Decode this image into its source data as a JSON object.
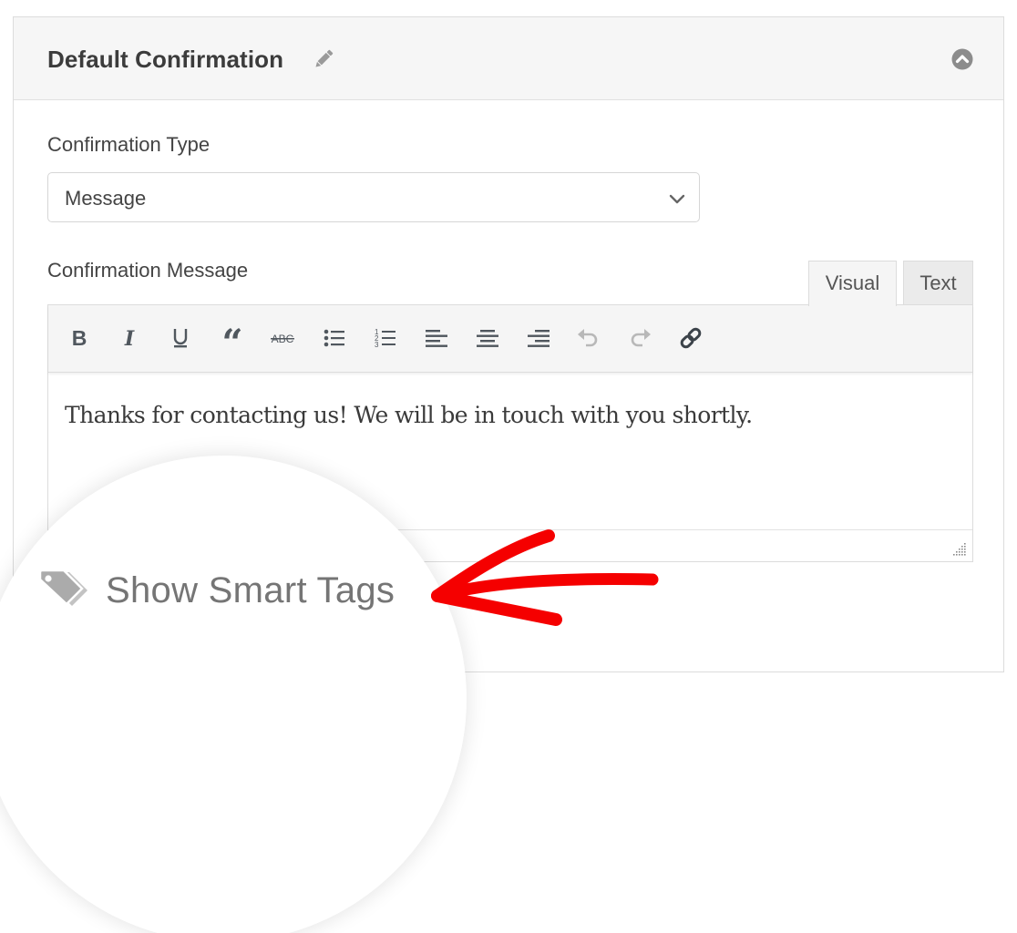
{
  "panel": {
    "title": "Default Confirmation",
    "edit_icon": "pencil-icon",
    "collapse_icon": "chevron-up-circle-icon"
  },
  "confirmation_type": {
    "label": "Confirmation Type",
    "selected": "Message",
    "icon": "chevron-down-icon"
  },
  "confirmation_message": {
    "label": "Confirmation Message",
    "tabs": [
      {
        "label": "Visual",
        "active": true
      },
      {
        "label": "Text",
        "active": false
      }
    ],
    "toolbar": [
      {
        "name": "bold",
        "icon": "bold-icon"
      },
      {
        "name": "italic",
        "icon": "italic-icon"
      },
      {
        "name": "underline",
        "icon": "underline-icon"
      },
      {
        "name": "blockquote",
        "icon": "quote-icon"
      },
      {
        "name": "strikethrough",
        "icon": "strikethrough-icon"
      },
      {
        "name": "bulleted-list",
        "icon": "bulleted-list-icon"
      },
      {
        "name": "numbered-list",
        "icon": "numbered-list-icon"
      },
      {
        "name": "align-left",
        "icon": "align-left-icon"
      },
      {
        "name": "align-center",
        "icon": "align-center-icon"
      },
      {
        "name": "align-right",
        "icon": "align-right-icon"
      },
      {
        "name": "undo",
        "icon": "undo-icon",
        "disabled": true
      },
      {
        "name": "redo",
        "icon": "redo-icon",
        "disabled": true
      },
      {
        "name": "link",
        "icon": "link-icon"
      }
    ],
    "content": "Thanks for contacting us! We will be in touch with you shortly."
  },
  "smart_tags": {
    "label": "Show Smart Tags",
    "icon": "tags-icon"
  },
  "annotation": {
    "arrow_color": "#f50000"
  },
  "colors": {
    "icon_dark": "#50575e",
    "icon_disabled": "#b8b8b8",
    "header_bg": "#f6f6f6"
  }
}
